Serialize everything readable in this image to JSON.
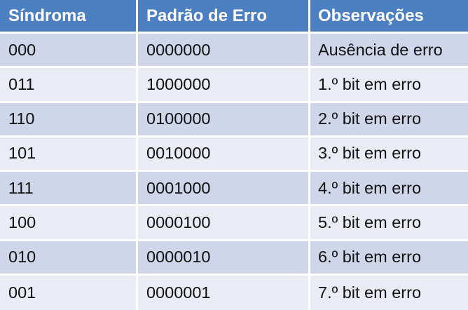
{
  "table": {
    "headers": [
      "Síndroma",
      "Padrão de Erro",
      "Observações"
    ],
    "rows": [
      [
        "000",
        "0000000",
        "Ausência de erro"
      ],
      [
        "011",
        "1000000",
        "1.º bit em erro"
      ],
      [
        "110",
        "0100000",
        "2.º bit em erro"
      ],
      [
        "101",
        "0010000",
        "3.º bit em erro"
      ],
      [
        "111",
        "0001000",
        "4.º bit em erro"
      ],
      [
        "100",
        "0000100",
        "5.º bit em erro"
      ],
      [
        "010",
        "0000010",
        "6.º bit em erro"
      ],
      [
        "001",
        "0000001",
        "7.º bit em erro"
      ]
    ]
  },
  "colors": {
    "header_bg": "#4d7fc3",
    "header_text": "#ffffff",
    "row_dark": "#cfd6e9",
    "row_light": "#e9ecf5"
  }
}
